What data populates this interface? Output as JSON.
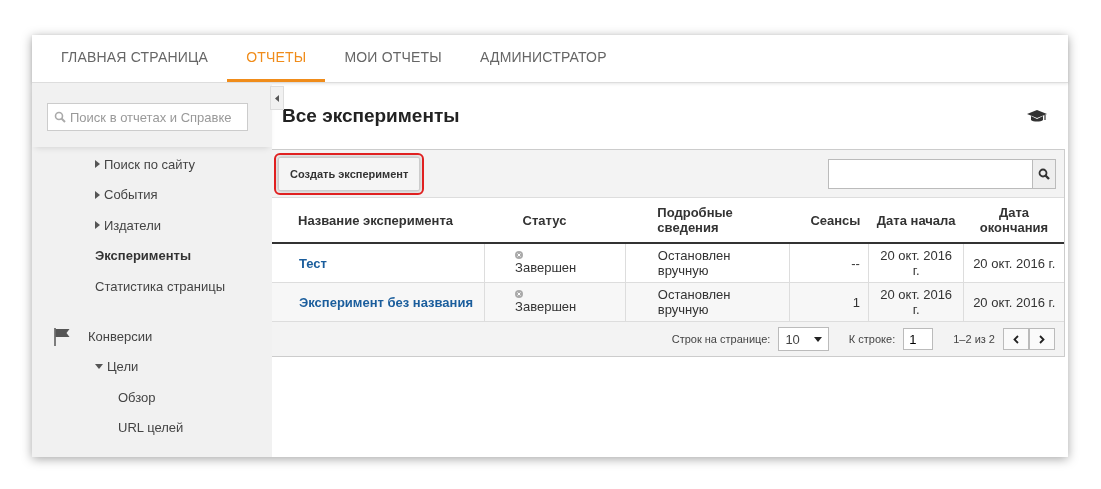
{
  "nav": {
    "tabs": [
      {
        "label": "ГЛАВНАЯ СТРАНИЦА",
        "selected": false
      },
      {
        "label": "ОТЧЕТЫ",
        "selected": true
      },
      {
        "label": "МОИ ОТЧЕТЫ",
        "selected": false
      },
      {
        "label": "АДМИНИСТРАТОР",
        "selected": false
      }
    ]
  },
  "sidebar": {
    "search": {
      "placeholder": "Поиск в отчетах и Справке"
    },
    "sections": [
      {
        "items": [
          {
            "label": "Поиск по сайту",
            "expandable": true,
            "expanded": false,
            "selected": false
          },
          {
            "label": "События",
            "expandable": true,
            "expanded": false,
            "selected": false
          },
          {
            "label": "Издатели",
            "expandable": true,
            "expanded": false,
            "selected": false
          },
          {
            "label": "Эксперименты",
            "expandable": false,
            "selected": true
          },
          {
            "label": "Статистика страницы",
            "expandable": false,
            "selected": false
          }
        ]
      },
      {
        "label": "Конверсии",
        "items": [
          {
            "label": "Цели",
            "expandable": true,
            "expanded": true,
            "selected": false,
            "children": [
              {
                "label": "Обзор",
                "selected": false
              },
              {
                "label": "URL целей",
                "selected": false
              }
            ]
          }
        ]
      }
    ]
  },
  "main": {
    "title": "Все эксперименты",
    "create_button": "Создать эксперимент",
    "table": {
      "columns": [
        "Название эксперимента",
        "Статус",
        "Подробные сведения",
        "Сеансы",
        "Дата начала",
        "Дата окончания"
      ],
      "rows": [
        {
          "name": "Тест",
          "status": "Завершен",
          "details": "Остановлен вручную",
          "sessions": "--",
          "start": "20 окт. 2016 г.",
          "end": "20 окт. 2016 г."
        },
        {
          "name": "Эксперимент без названия",
          "status": "Завершен",
          "details": "Остановлен вручную",
          "sessions": "1",
          "start": "20 окт. 2016 г.",
          "end": "20 окт. 2016 г."
        }
      ]
    },
    "pager": {
      "rows_label": "Строк на странице:",
      "rows_value": "10",
      "goto_label": "К строке:",
      "goto_value": "1",
      "range": "1–2 из 2"
    }
  }
}
